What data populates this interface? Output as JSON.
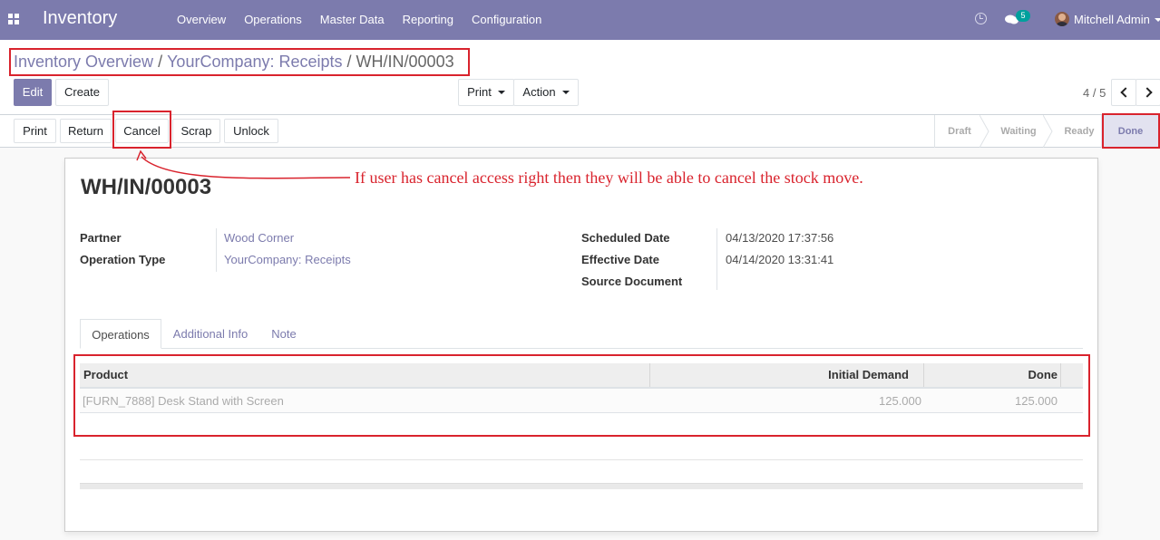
{
  "navbar": {
    "brand": "Inventory",
    "menu": [
      "Overview",
      "Operations",
      "Master Data",
      "Reporting",
      "Configuration"
    ],
    "icons": {
      "apps": "apps-grid-icon",
      "activity": "clock-icon",
      "messages": "chat-icon"
    },
    "messages_count": "5",
    "user_name": "Mitchell Admin"
  },
  "breadcrumb": {
    "items": [
      "Inventory Overview",
      "YourCompany: Receipts"
    ],
    "separator": "/",
    "current": "WH/IN/00003"
  },
  "toolbar": {
    "edit_label": "Edit",
    "create_label": "Create",
    "print_label": "Print",
    "action_label": "Action",
    "pager_value": "4 / 5"
  },
  "statusbar": {
    "buttons": [
      "Print",
      "Return",
      "Cancel",
      "Scrap",
      "Unlock"
    ],
    "stages": [
      "Draft",
      "Waiting",
      "Ready",
      "Done"
    ],
    "current_stage": "Done"
  },
  "annotation": {
    "text": "If user has cancel access right then they will be able to cancel the stock move."
  },
  "form": {
    "title": "WH/IN/00003",
    "left_fields": [
      {
        "label": "Partner",
        "value": "Wood Corner"
      },
      {
        "label": "Operation Type",
        "value": "YourCompany: Receipts"
      }
    ],
    "right_fields": [
      {
        "label": "Scheduled Date",
        "value": "04/13/2020 17:37:56"
      },
      {
        "label": "Effective Date",
        "value": "04/14/2020 13:31:41"
      },
      {
        "label": "Source Document",
        "value": ""
      }
    ],
    "tabs": [
      "Operations",
      "Additional Info",
      "Note"
    ],
    "active_tab": "Operations",
    "table": {
      "columns": [
        "Product",
        "Initial Demand",
        "Done"
      ],
      "rows": [
        {
          "product": "[FURN_7888] Desk Stand with Screen",
          "initial_demand": "125.000",
          "done": "125.000"
        }
      ]
    }
  },
  "colors": {
    "brand": "#7c7bad",
    "annotation_red": "#d9232d",
    "badge": "#00a09d"
  }
}
